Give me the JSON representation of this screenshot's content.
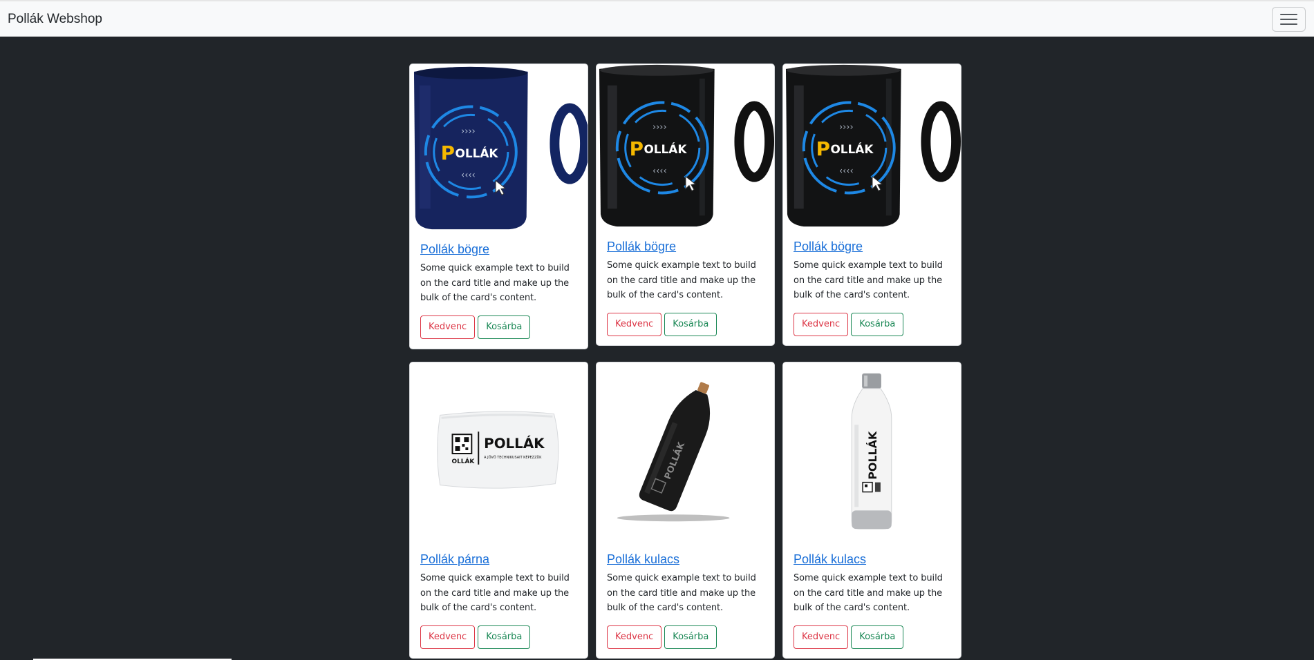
{
  "navbar": {
    "brand": "Pollák Webshop",
    "menu_icon": "hamburger-icon"
  },
  "products": [
    {
      "title": "Pollák bögre",
      "text": "Some quick example text to build on the card title and make up the bulk of the card's content.",
      "fav_label": "Kedvenc",
      "cart_label": "Kosárba",
      "image": "blue-mug"
    },
    {
      "title": "Pollák bögre",
      "text": "Some quick example text to build on the card title and make up the bulk of the card's content.",
      "fav_label": "Kedvenc",
      "cart_label": "Kosárba",
      "image": "black-mug"
    },
    {
      "title": "Pollák bögre",
      "text": "Some quick example text to build on the card title and make up the bulk of the card's content.",
      "fav_label": "Kedvenc",
      "cart_label": "Kosárba",
      "image": "black-mug"
    },
    {
      "title": "Pollák párna",
      "text": "Some quick example text to build on the card title and make up the bulk of the card's content.",
      "fav_label": "Kedvenc",
      "cart_label": "Kosárba",
      "image": "pillow"
    },
    {
      "title": "Pollák kulacs",
      "text": "Some quick example text to build on the card title and make up the bulk of the card's content.",
      "fav_label": "Kedvenc",
      "cart_label": "Kosárba",
      "image": "black-bottle"
    },
    {
      "title": "Pollák kulacs",
      "text": "Some quick example text to build on the card title and make up the bulk of the card's content.",
      "fav_label": "Kedvenc",
      "cart_label": "Kosárba",
      "image": "white-bottle"
    }
  ],
  "product_art": {
    "mug_logo": "OLLÁK",
    "mug_logo_initial": "P",
    "pillow_logo": "POLLÁK",
    "pillow_tagline": "A JÖVŐ TECHNIKUSAIT KÉPEZZÜK",
    "bottle_logo": "POLLÁK",
    "qr_label": "OLLÁK"
  },
  "colors": {
    "page_bg": "#212529",
    "navbar_bg": "#f8f9fa",
    "link": "#1a6fd8",
    "danger": "#dc3545",
    "success": "#198754",
    "logo_blue": "#1e88e5",
    "logo_gold": "#f5b800"
  }
}
